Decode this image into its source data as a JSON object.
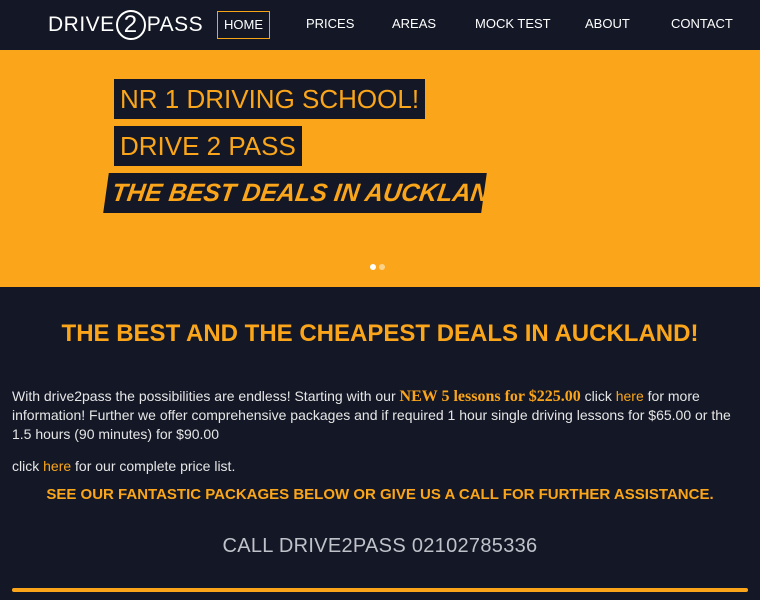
{
  "header": {
    "logo": {
      "part1": "DRIVE",
      "part2": "2",
      "part3": "PASS"
    },
    "nav": [
      {
        "label": "HOME",
        "active": true
      },
      {
        "label": "PRICES",
        "active": false
      },
      {
        "label": "AREAS",
        "active": false
      },
      {
        "label": "MOCK TEST",
        "active": false
      },
      {
        "label": "ABOUT",
        "active": false
      },
      {
        "label": "CONTACT",
        "active": false
      }
    ]
  },
  "hero": {
    "line1": "NR 1 DRIVING SCHOOL!",
    "line2": "DRIVE 2 PASS",
    "line3": "THE BEST DEALS IN AUCKLAND...",
    "slides": 2,
    "active_slide": 1
  },
  "main": {
    "heading": "THE BEST AND THE CHEAPEST DEALS IN AUCKLAND!",
    "p1_a": "With drive2pass the possibilities are endless! Starting with our ",
    "p1_highlight": "NEW 5 lessons for $225.00",
    "p1_b": " click ",
    "p1_link": "here",
    "p1_c": " for more information! Further we offer comprehensive packages and if required 1 hour single driving lessons for $65.00 or the 1.5 hours (90 minutes) for $90.00",
    "p2_a": "click ",
    "p2_link": "here",
    "p2_b": " for our complete price list.",
    "subheading": "SEE OUR FANTASTIC PACKAGES BELOW OR GIVE US A CALL FOR FURTHER ASSISTANCE.",
    "call": "CALL DRIVE2PASS 02102785336"
  },
  "colors": {
    "accent": "#fba61a",
    "background": "#141826",
    "text": "#e6e6e6"
  }
}
